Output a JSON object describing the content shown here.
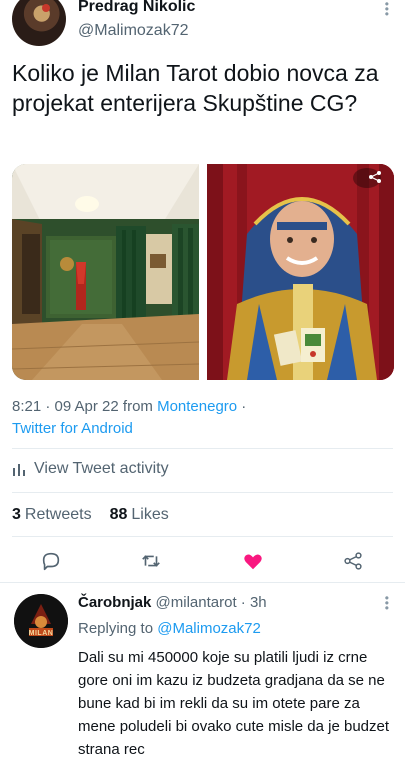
{
  "author": {
    "name": "Predrag Nikolic",
    "handle": "@Malimozak72"
  },
  "tweet": {
    "text": "Koliko je Milan Tarot dobio novca za projekat enterijera Skupštine CG?",
    "time": "8:21 · 09 Apr 22 from ",
    "location": "Montenegro",
    "separator": " ·",
    "client": "Twitter for Android",
    "photos": [
      "parliament-interior-photo",
      "tarot-reader-photo"
    ]
  },
  "activity": {
    "label": "View Tweet activity",
    "icon": "bar-chart-icon"
  },
  "stats": {
    "retweets_count": "3",
    "retweets_label": "Retweets",
    "likes_count": "88",
    "likes_label": "Likes"
  },
  "actions": {
    "reply_icon": "reply-icon",
    "retweet_icon": "retweet-icon",
    "like_icon": "heart-filled-icon",
    "share_icon": "share-icon",
    "like_color": "#f91880",
    "icon_color": "#536471"
  },
  "reply": {
    "name": "Čarobnjak",
    "handle": "@milantarot",
    "time_sep": " · ",
    "time": "3h",
    "replying_prefix": "Replying to ",
    "replying_to": "@Malimozak72",
    "avatar_text": "MILAN",
    "text": "Dali su mi 450000 koje su platili ljudi iz crne gore oni im kazu iz budzeta gradjana da se ne bune kad bi im rekli da su im otete pare za mene poludeli bi ovako cute misle da je budzet strana rec"
  },
  "colors": {
    "link": "#1d9bf0",
    "secondary_text": "#536471",
    "primary_text": "#0f1419"
  }
}
